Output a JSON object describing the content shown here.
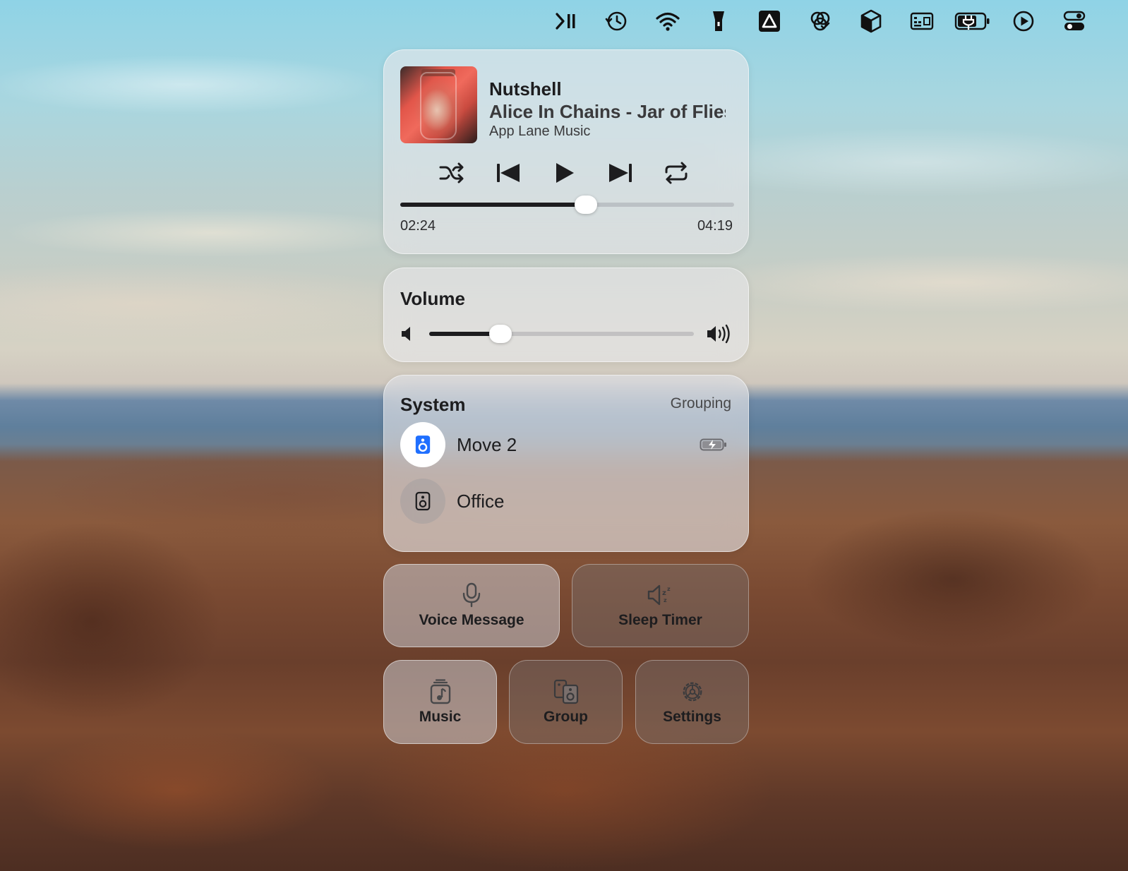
{
  "menubar": {
    "icons": [
      "play-pause-icon",
      "time-machine-icon",
      "wifi-icon",
      "flashlight-icon",
      "app-lane-icon",
      "ai-assistant-icon",
      "package-icon",
      "keyboard-shortcut-icon",
      "battery-charging-icon",
      "play-circle-icon",
      "control-center-icon"
    ]
  },
  "now_playing": {
    "title": "Nutshell",
    "artist_album": "Alice In Chains - Jar of Flies",
    "source": "App Lane Music",
    "elapsed": "02:24",
    "duration": "04:19",
    "progress": 0.556
  },
  "volume": {
    "title": "Volume",
    "level": 0.27
  },
  "system": {
    "title": "System",
    "action": "Grouping",
    "speakers": [
      {
        "name": "Move 2",
        "active": true,
        "battery": "charging"
      },
      {
        "name": "Office",
        "active": false
      }
    ]
  },
  "tiles": {
    "voice_message": "Voice Message",
    "sleep_timer": "Sleep Timer",
    "music": "Music",
    "group": "Group",
    "settings": "Settings"
  },
  "colors": {
    "accent": "#1f6fff",
    "text": "#1d1d1f"
  }
}
